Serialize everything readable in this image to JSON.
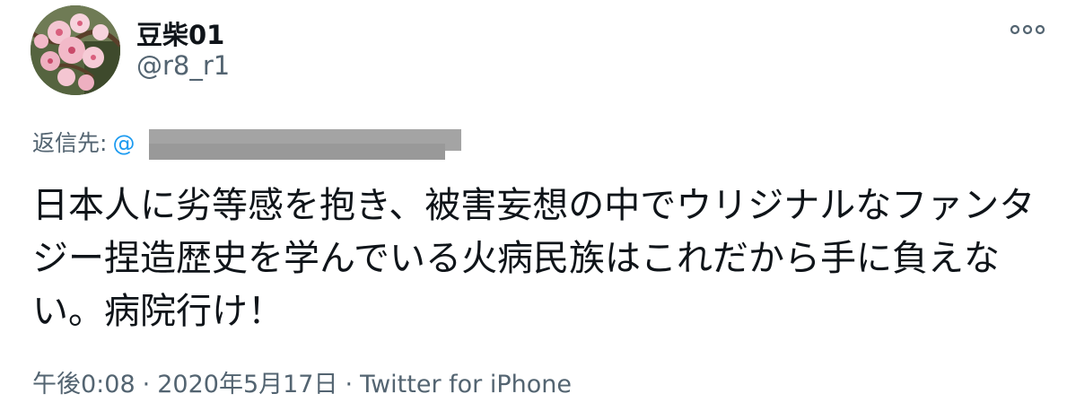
{
  "tweet": {
    "display_name": "豆柴01",
    "handle": "@r8_r1",
    "reply_prefix": "返信先:",
    "reply_to": "@",
    "text": "日本人に劣等感を抱き、被害妄想の中でウリジナルなファンタジー捏造歴史を学んでいる火病民族はこれだから手に負えない。病院行け！",
    "time": "午後0:08",
    "date": "2020年5月17日",
    "separator": "·",
    "source": "Twitter for iPhone"
  },
  "icons": {
    "more": "more-options-icon",
    "avatar": "cherry-blossom-avatar"
  },
  "colors": {
    "primary_text": "#0f1419",
    "secondary_text": "#536471",
    "link": "#1d9bf0",
    "redaction": "#a4a4a4"
  }
}
